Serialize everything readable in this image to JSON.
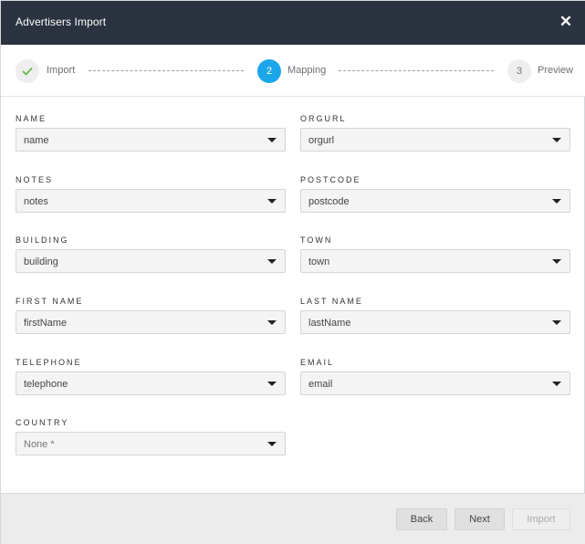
{
  "dialog": {
    "title": "Advertisers Import",
    "close_icon": "close-icon"
  },
  "stepper": {
    "steps": [
      {
        "number": "",
        "label": "Import",
        "state": "done",
        "icon": "check-icon"
      },
      {
        "number": "2",
        "label": "Mapping",
        "state": "active"
      },
      {
        "number": "3",
        "label": "Preview",
        "state": "pending"
      }
    ]
  },
  "fields": [
    {
      "label": "NAME",
      "value": "name"
    },
    {
      "label": "ORGURL",
      "value": "orgurl"
    },
    {
      "label": "NOTES",
      "value": "notes"
    },
    {
      "label": "POSTCODE",
      "value": "postcode"
    },
    {
      "label": "BUILDING",
      "value": "building"
    },
    {
      "label": "TOWN",
      "value": "town"
    },
    {
      "label": "FIRST NAME",
      "value": "firstName"
    },
    {
      "label": "LAST NAME",
      "value": "lastName"
    },
    {
      "label": "TELEPHONE",
      "value": "telephone"
    },
    {
      "label": "EMAIL",
      "value": "email"
    },
    {
      "label": "COUNTRY",
      "value": "None *"
    }
  ],
  "footer": {
    "back_label": "Back",
    "next_label": "Next",
    "import_label": "Import"
  },
  "colors": {
    "header_bg": "#2b3240",
    "active_step": "#1ba6ea",
    "done_check": "#66b84a"
  }
}
